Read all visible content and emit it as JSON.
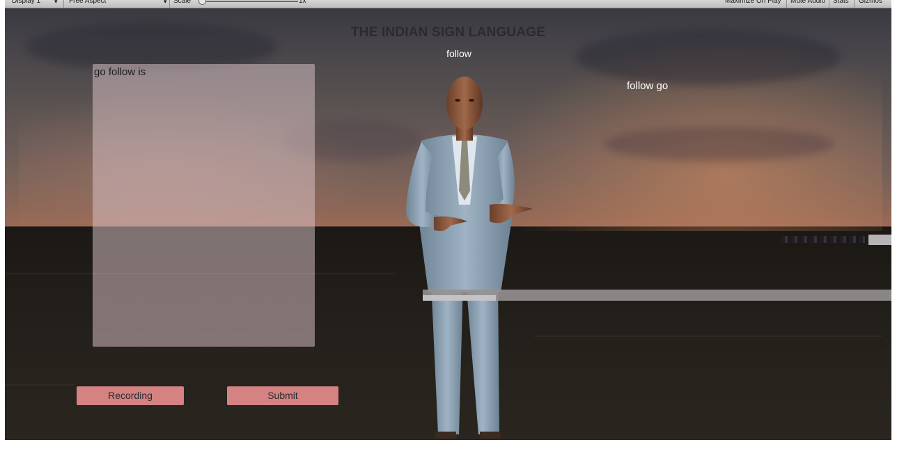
{
  "toolbar": {
    "display": "Display 1",
    "aspect": "Free Aspect",
    "scale_label": "Scale",
    "scale_value": "1x",
    "maximize_on_play": "Maximize On Play",
    "mute_audio": "Mute Audio",
    "stats": "Stats",
    "gizmos": "Gizmos"
  },
  "game": {
    "title": "THE INDIAN SIGN LANGUAGE",
    "current_word": "follow",
    "sentence": "follow go",
    "input_text": "go follow is",
    "recording_label": "Recording",
    "submit_label": "Submit"
  },
  "colors": {
    "button": "#d48282",
    "panel": "#dac4c8",
    "suit": "#8aa3b8"
  },
  "icons": {
    "avatar": "3d-avatar-man-in-suit-signing"
  }
}
